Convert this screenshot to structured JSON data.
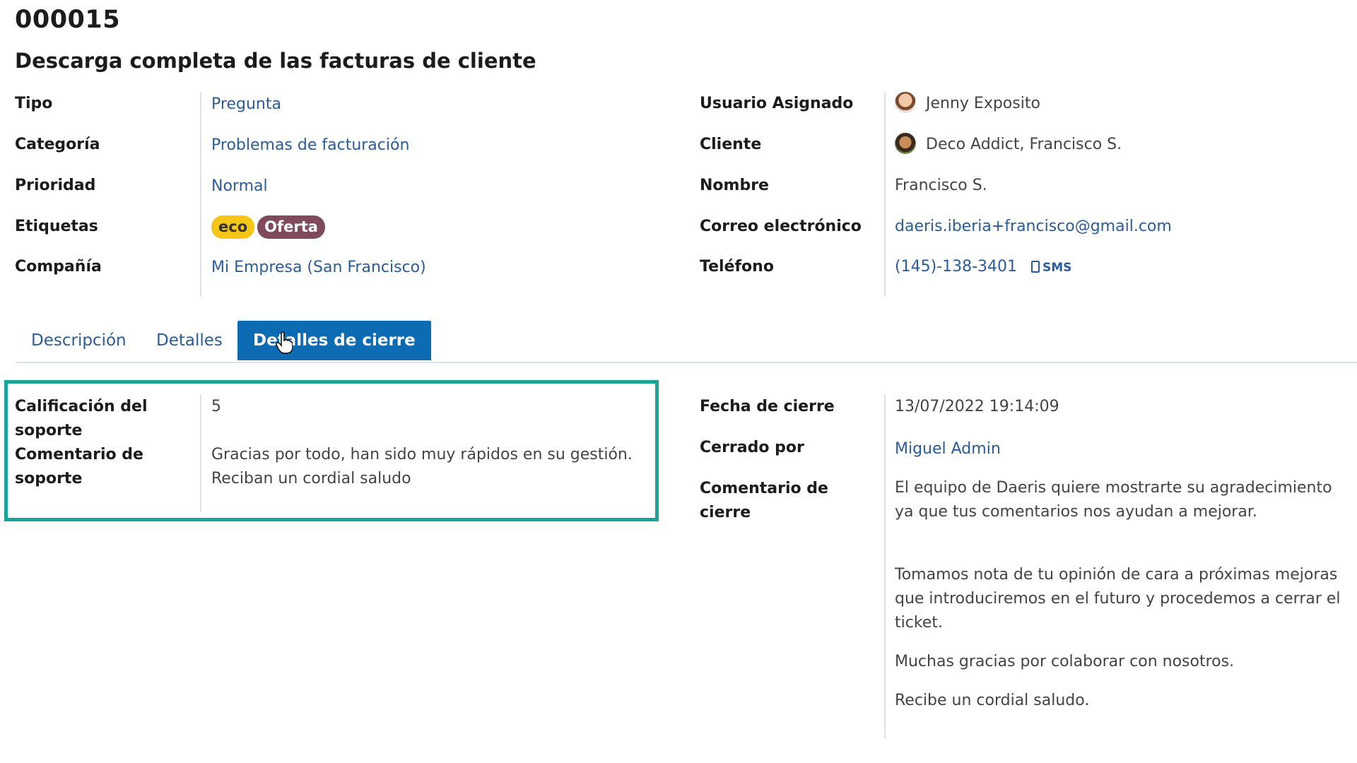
{
  "ticket": {
    "ref": "000015",
    "title": "Descarga completa de las facturas de cliente"
  },
  "left_fields": {
    "tipo": {
      "label": "Tipo",
      "value": "Pregunta"
    },
    "categoria": {
      "label": "Categoría",
      "value": "Problemas de facturación"
    },
    "prioridad": {
      "label": "Prioridad",
      "value": "Normal"
    },
    "etiquetas": {
      "label": "Etiquetas",
      "tags": [
        "eco",
        "Oferta"
      ]
    },
    "compania": {
      "label": "Compañía",
      "value": "Mi Empresa (San Francisco)"
    }
  },
  "right_fields": {
    "usuario": {
      "label": "Usuario Asignado",
      "value": "Jenny Exposito",
      "avatar": "user-avatar"
    },
    "cliente": {
      "label": "Cliente",
      "value": "Deco Addict, Francisco S.",
      "avatar": "customer-avatar"
    },
    "nombre": {
      "label": "Nombre",
      "value": "Francisco S."
    },
    "correo": {
      "label": "Correo electrónico",
      "value": "daeris.iberia+francisco@gmail.com"
    },
    "telefono": {
      "label": "Teléfono",
      "value": "(145)-138-3401",
      "sms": "SMS"
    }
  },
  "tabs": [
    {
      "label": "Descripción",
      "active": false
    },
    {
      "label": "Detalles",
      "active": false
    },
    {
      "label": "Detalles de cierre",
      "active": true
    }
  ],
  "closing_left": {
    "calificacion": {
      "label_l1": "Calificación del",
      "label_l2": "soporte",
      "value": "5"
    },
    "comentario": {
      "label_l1": "Comentario de",
      "label_l2": "soporte",
      "value_l1": "Gracias por todo, han sido muy rápidos en su gestión.",
      "value_l2": "Reciban un cordial saludo"
    }
  },
  "closing_right": {
    "fecha": {
      "label": "Fecha de cierre",
      "value": "13/07/2022 19:14:09"
    },
    "cerrado_por": {
      "label": "Cerrado por",
      "value": "Miguel Admin"
    },
    "comentario_cierre": {
      "label_l1": "Comentario de",
      "label_l2": "cierre",
      "paragraphs": [
        "El equipo de Daeris quiere mostrarte su agradecimiento ya que tus comentarios nos ayudan a mejorar.",
        "Tomamos nota de tu opinión de cara a próximas mejoras que introduciremos en el futuro y procedemos a cerrar el ticket.",
        "Muchas gracias por colaborar con nosotros.",
        "Recibe un cordial saludo."
      ]
    }
  },
  "colors": {
    "link": "#2a5c9a",
    "active_tab": "#0c6bb3",
    "highlight_border": "#1aa39a",
    "tag_eco": "#f5c518",
    "tag_oferta": "#7f4a5d"
  }
}
